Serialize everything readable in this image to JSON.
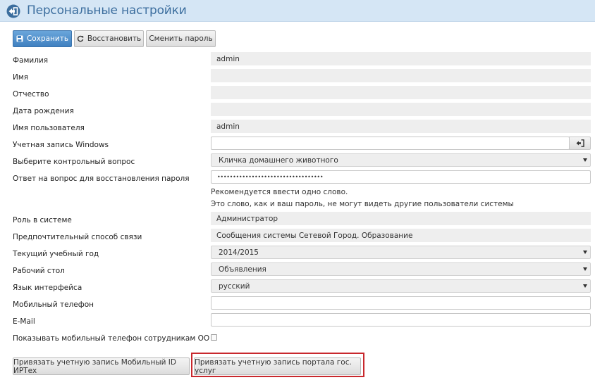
{
  "header": {
    "title": "Персональные настройки"
  },
  "toolbar": {
    "save_label": "Сохранить",
    "restore_label": "Восстановить",
    "change_password_label": "Сменить пароль"
  },
  "form": {
    "surname": {
      "label": "Фамилия",
      "value": "admin"
    },
    "name": {
      "label": "Имя",
      "value": ""
    },
    "patronymic": {
      "label": "Отчество",
      "value": ""
    },
    "birthdate": {
      "label": "Дата рождения",
      "value": ""
    },
    "username": {
      "label": "Имя пользователя",
      "value": "admin"
    },
    "windows_account": {
      "label": "Учетная запись Windows",
      "value": ""
    },
    "security_question": {
      "label": "Выберите контрольный вопрос",
      "value": "Кличка домашнего животного"
    },
    "security_answer": {
      "label": "Ответ на вопрос для восстановления пароля",
      "value": "••••••••••••••••••••••••••••••••••"
    },
    "hint_line1": "Рекомендуется ввести одно слово.",
    "hint_line2": "Это слово, как и ваш пароль, не могут видеть другие пользователи системы",
    "role": {
      "label": "Роль в системе",
      "value": "Администратор"
    },
    "contact_method": {
      "label": "Предпочтительный способ связи",
      "value": "Сообщения системы Сетевой Город. Образование"
    },
    "school_year": {
      "label": "Текущий учебный год",
      "value": "2014/2015"
    },
    "desktop": {
      "label": "Рабочий стол",
      "value": "Объявления"
    },
    "language": {
      "label": "Язык интерфейса",
      "value": "русский"
    },
    "mobile_phone": {
      "label": "Мобильный телефон",
      "value": ""
    },
    "email": {
      "label": "E-Mail",
      "value": ""
    },
    "show_mobile": {
      "label": "Показывать мобильный телефон сотрудникам ОО",
      "checked": false
    }
  },
  "footer": {
    "bind_mobile_id_label": "Привязать учетную запись Мобильный ID ИРТех",
    "bind_gosuslugi_label": "Привязать учетную запись портала гос. услуг"
  },
  "colors": {
    "header_bg": "#d5e6f5",
    "primary": "#3f80c0",
    "highlight": "#c8282d"
  }
}
